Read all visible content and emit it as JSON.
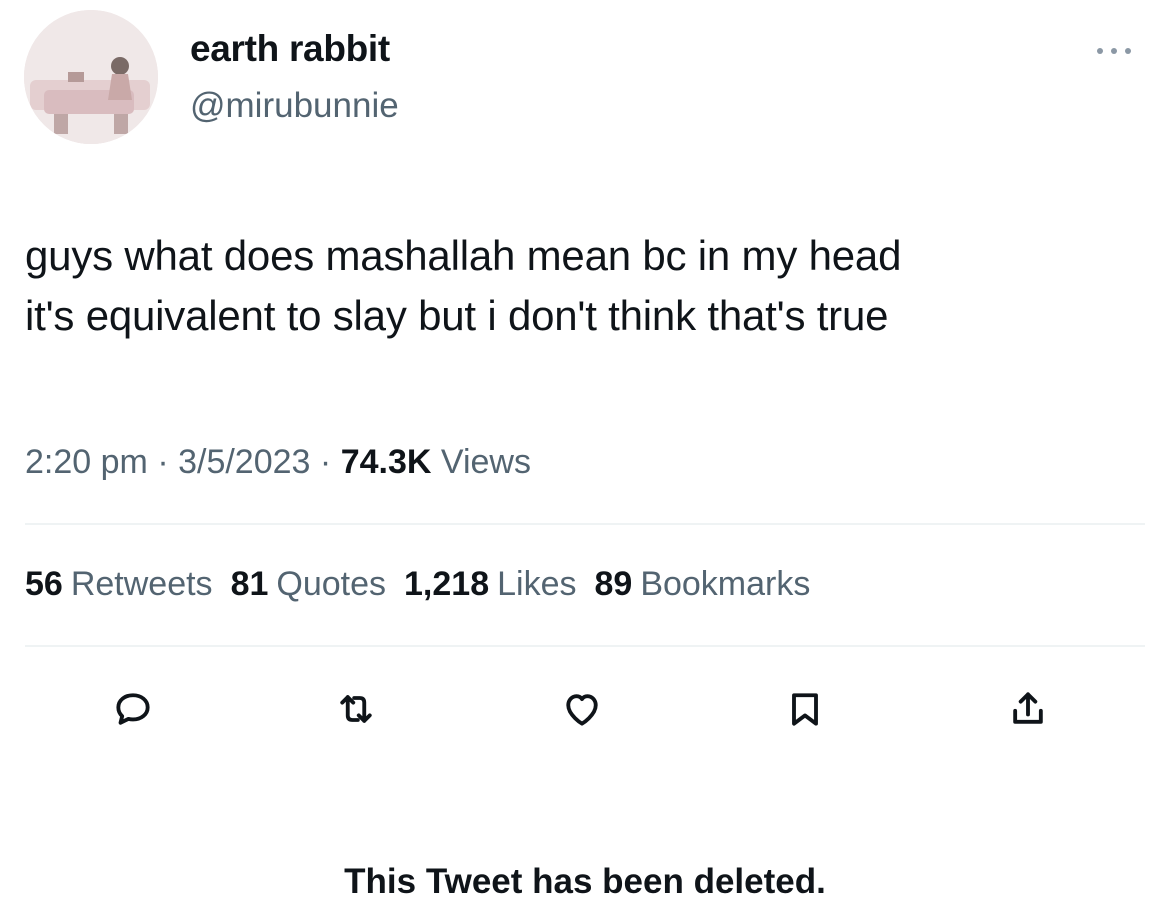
{
  "author": {
    "display_name": "earth rabbit",
    "handle": "@mirubunnie"
  },
  "tweet": {
    "text_lines": [
      "guys what does mashallah mean bc in my head",
      "it's equivalent to slay but i don't think that's true"
    ]
  },
  "meta": {
    "time": "2:20 pm",
    "date": "3/5/2023",
    "separator": "·",
    "views_count": "74.3K",
    "views_label": "Views"
  },
  "stats": [
    {
      "count": "56",
      "label": "Retweets"
    },
    {
      "count": "81",
      "label": "Quotes"
    },
    {
      "count": "1,218",
      "label": "Likes"
    },
    {
      "count": "89",
      "label": "Bookmarks"
    }
  ],
  "actions": [
    "reply-icon",
    "retweet-icon",
    "like-icon",
    "bookmark-icon",
    "share-icon"
  ],
  "notice": "This Tweet has been deleted.",
  "colors": {
    "text": "#0f1419",
    "secondary_text": "#536471",
    "divider": "#eff3f4"
  }
}
